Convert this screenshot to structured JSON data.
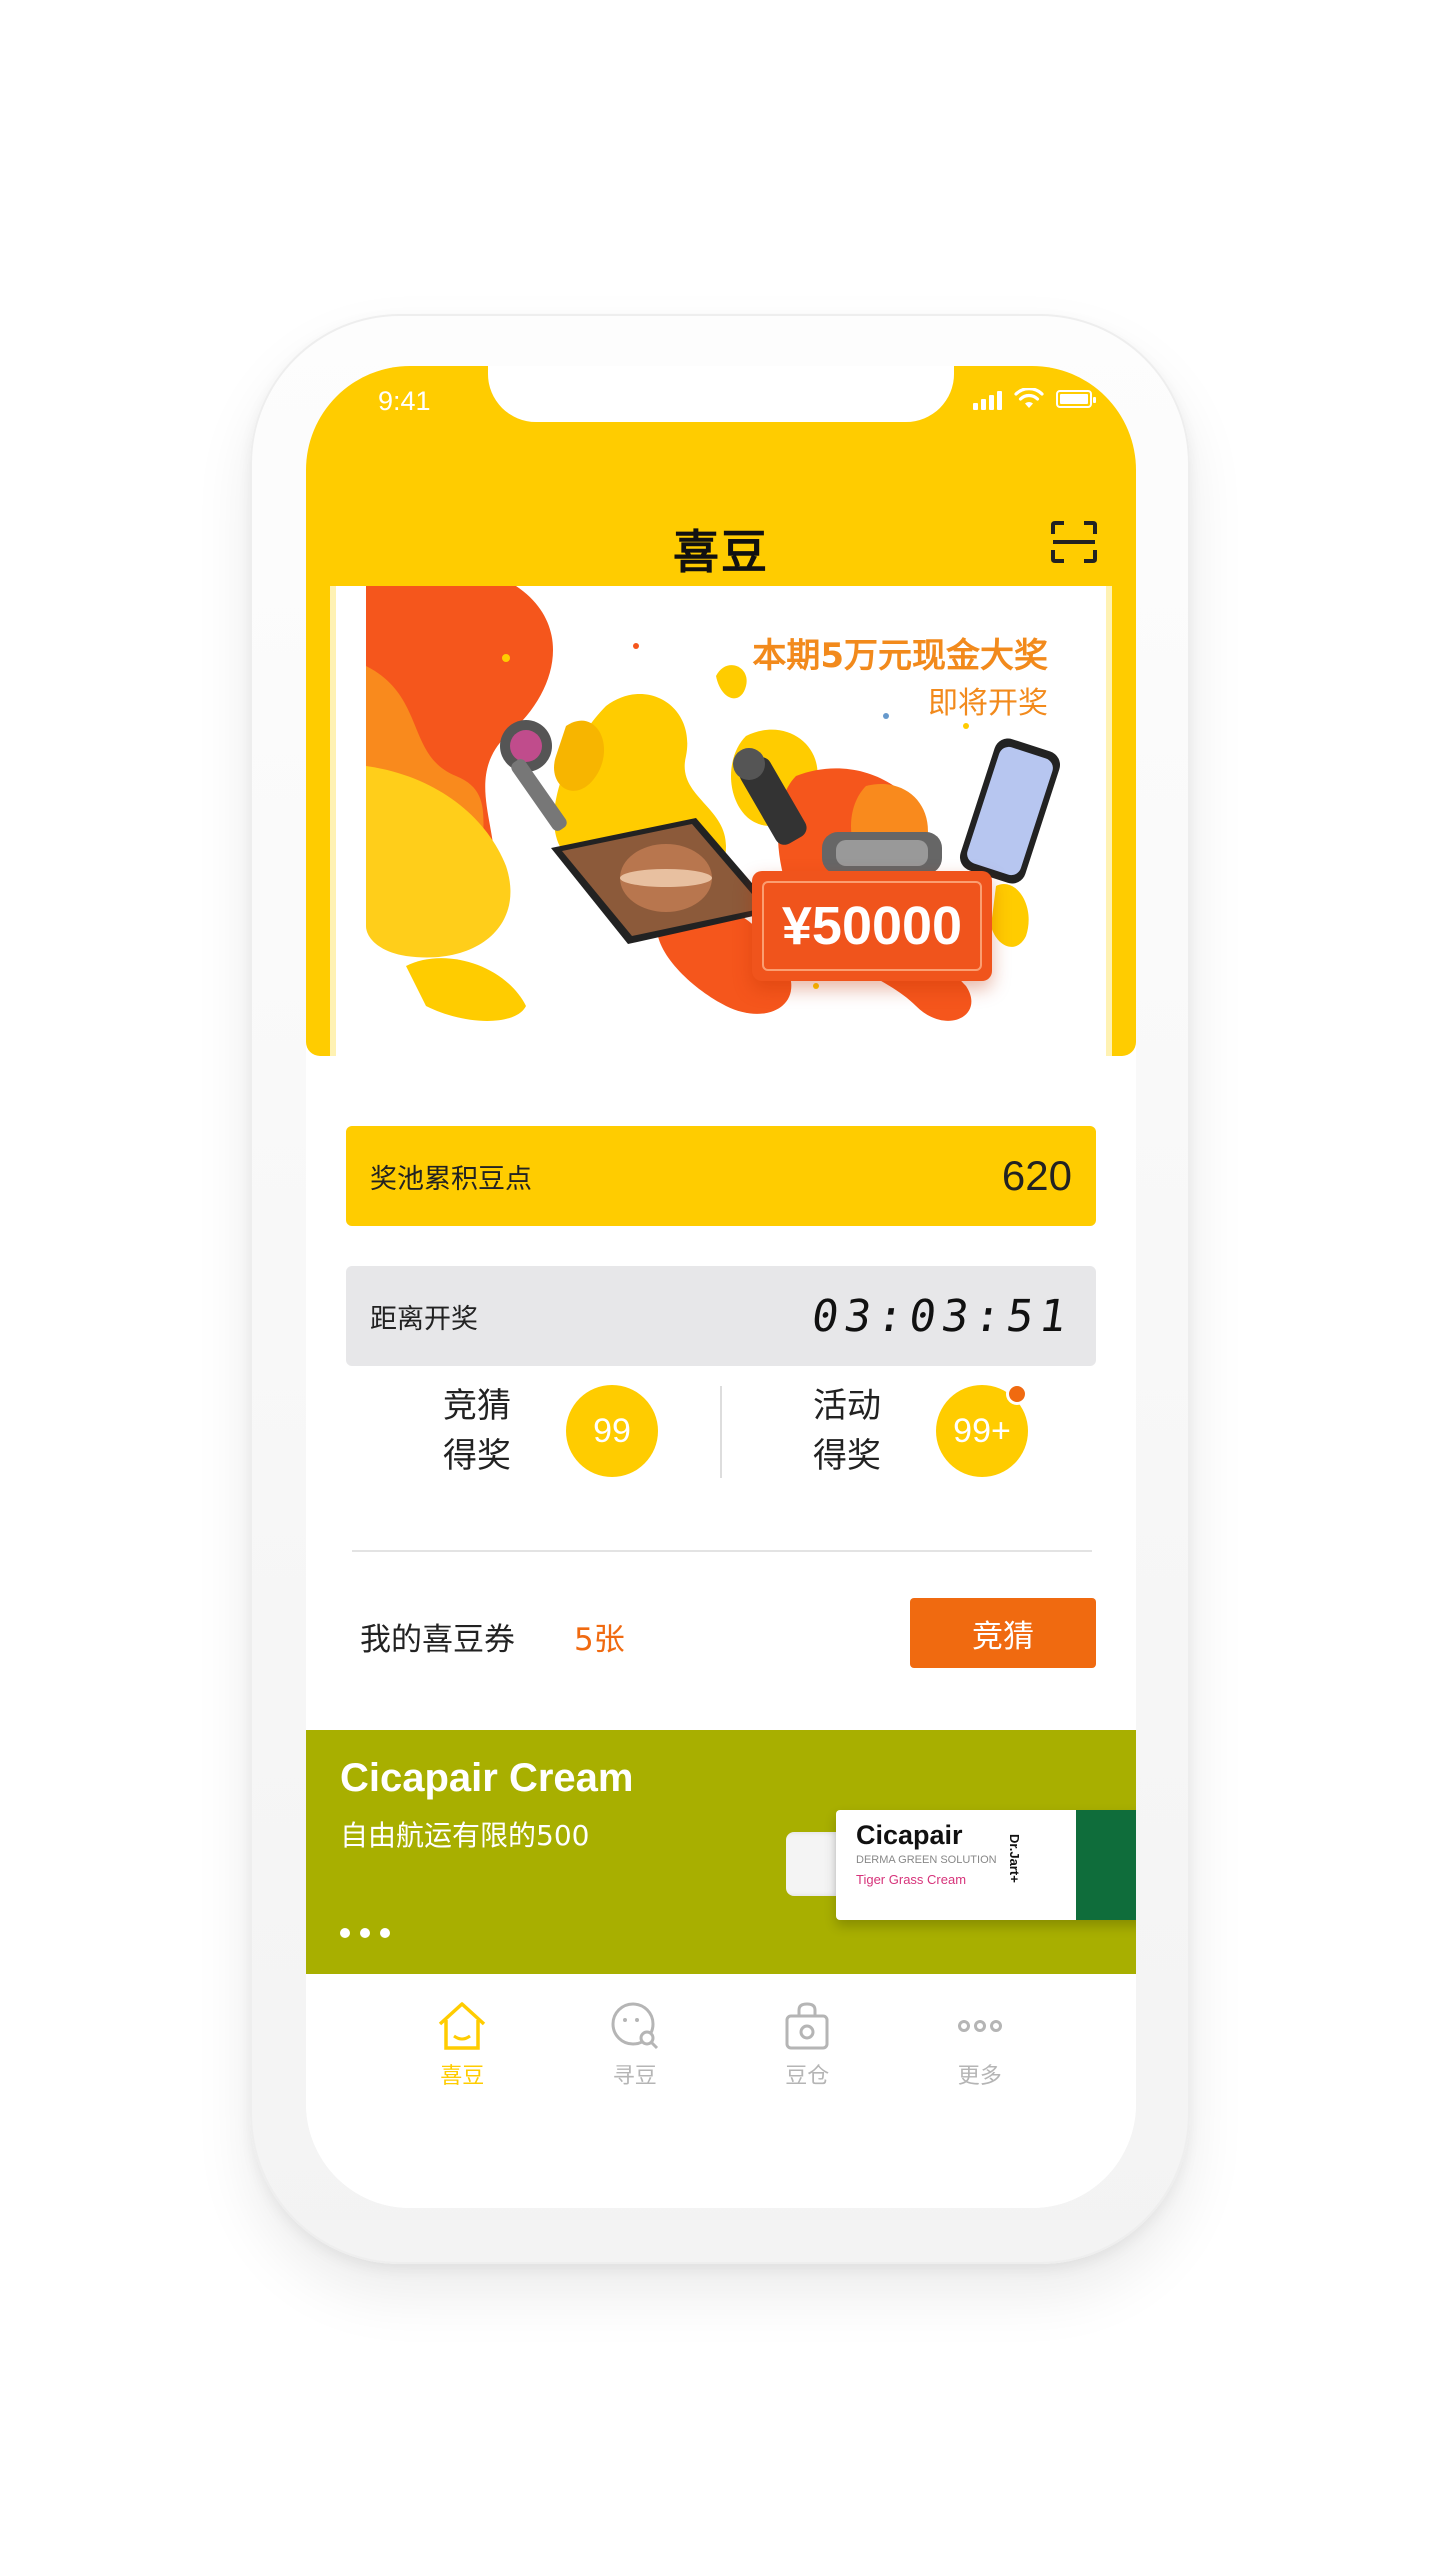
{
  "status_bar": {
    "time": "9:41"
  },
  "header": {
    "title": "喜豆"
  },
  "banner": {
    "title": "本期5万元现金大奖",
    "subtitle": "即将开奖",
    "prize": "¥50000"
  },
  "pool": {
    "label": "奖池累积豆点",
    "value": "620"
  },
  "timer": {
    "label": "距离开奖",
    "value": "03:03:51"
  },
  "stats": {
    "guess": {
      "label_line1": "竞猜",
      "label_line2": "得奖",
      "count": "99"
    },
    "activity": {
      "label_line1": "活动",
      "label_line2": "得奖",
      "count": "99+"
    }
  },
  "coupon": {
    "label": "我的喜豆券",
    "count": "5张",
    "button_label": "竞猜"
  },
  "ad": {
    "title": "Cicapair Cream",
    "subtitle": "自由航运有限的500",
    "product_brand": "Cicapair",
    "product_line": "DERMA GREEN SOLUTION",
    "product_name": "Tiger Grass Cream",
    "product_maker": "Dr.Jart+"
  },
  "tabbar": {
    "tabs": [
      {
        "label": "喜豆",
        "icon": "home-icon",
        "active": true
      },
      {
        "label": "寻豆",
        "icon": "search-chat-icon",
        "active": false
      },
      {
        "label": "豆仓",
        "icon": "bag-icon",
        "active": false
      },
      {
        "label": "更多",
        "icon": "more-icon",
        "active": false
      }
    ]
  },
  "colors": {
    "primary": "#ffcc00",
    "accent": "#f06a10",
    "ad_background": "#a8af00",
    "timer_card": "#e7e7e9"
  }
}
